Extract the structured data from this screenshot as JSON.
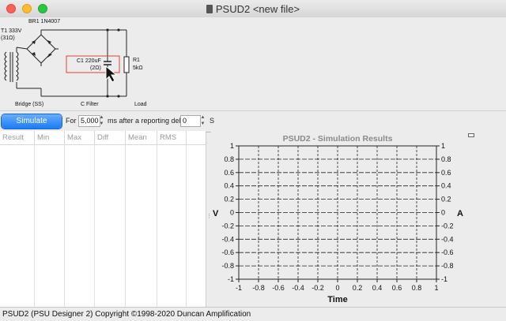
{
  "window": {
    "title": "PSUD2 <new file>"
  },
  "schematic": {
    "transformer": {
      "label": "T1 333V",
      "resistance": "(31Ω)"
    },
    "rectifier": {
      "label": "BR1 1N4007"
    },
    "capacitor": {
      "label": "C1 220uF",
      "resistance": "(2Ω)"
    },
    "resistor": {
      "label": "R1",
      "value": "5kΩ"
    },
    "sections": {
      "bridge": "Bridge (SS)",
      "filter": "C Filter",
      "load": "Load"
    }
  },
  "toolbar": {
    "simulate_label": "Simulate",
    "for_label": "For",
    "duration_value": "5,000",
    "ms_label": "ms after a reporting delay",
    "delay_value": "0",
    "s_label": "S"
  },
  "results_table": {
    "columns": [
      "Result",
      "Min",
      "Max",
      "Diff",
      "Mean",
      "RMS"
    ],
    "rows": []
  },
  "plot": {
    "title": "PSUD2 - Simulation Results",
    "xlabel": "Time",
    "ylabel_left": "V",
    "ylabel_right": "A"
  },
  "chart_data": {
    "type": "line",
    "title": "PSUD2 - Simulation Results",
    "xlabel": "Time",
    "ylabel": "V",
    "y2label": "A",
    "xlim": [
      -1,
      1
    ],
    "ylim": [
      -1,
      1
    ],
    "y2lim": [
      -1,
      1
    ],
    "x_ticks": [
      "-1",
      "-0.8",
      "-0.6",
      "-0.4",
      "-0.2",
      "0",
      "0.2",
      "0.4",
      "0.6",
      "0.8",
      "1"
    ],
    "y_ticks": [
      "1",
      "0.8",
      "0.6",
      "0.4",
      "0.2",
      "0",
      "-0.2",
      "-0.4",
      "-0.6",
      "-0.8",
      "-1"
    ],
    "grid": true,
    "series": []
  },
  "status": {
    "text": "PSUD2 (PSU Designer 2)  Copyright ©1998-2020 Duncan Amplification"
  }
}
